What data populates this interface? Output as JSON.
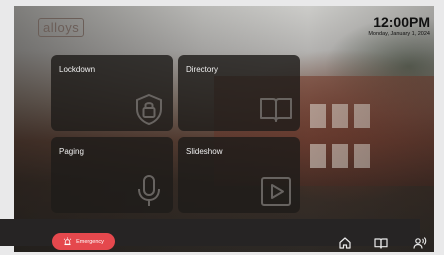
{
  "header": {
    "logo_text": "alloys",
    "time": "12:00PM",
    "date": "Monday, January 1, 2024"
  },
  "tiles": [
    {
      "label": "Lockdown",
      "icon": "lock-icon"
    },
    {
      "label": "Directory",
      "icon": "book-icon"
    },
    {
      "label": "Paging",
      "icon": "microphone-icon"
    },
    {
      "label": "Slideshow",
      "icon": "play-icon"
    }
  ],
  "footer": {
    "emergency_label": "Emergency",
    "emergency_color": "#e5484d",
    "nav": [
      "home-icon",
      "book-icon",
      "announcement-icon"
    ]
  }
}
